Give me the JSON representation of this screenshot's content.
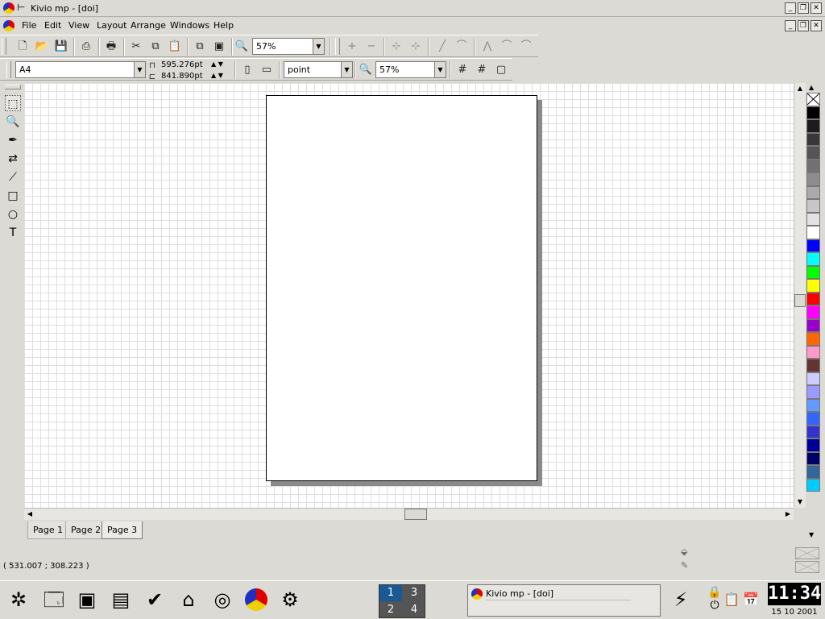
{
  "window": {
    "title": "Kivio mp - [doi]"
  },
  "menu": {
    "items": [
      "File",
      "Edit",
      "View",
      "Layout",
      "Arrange",
      "Windows",
      "Help"
    ]
  },
  "toolbar1": {
    "zoom_value": "57%",
    "icons": [
      "new-icon",
      "open-icon",
      "save-icon",
      "print-preview-icon",
      "print-icon",
      "cut-icon",
      "copy-icon",
      "paste-icon",
      "copy-to-page-icon",
      "paste-from-page-icon",
      "zoom-icon",
      "add-point-icon",
      "remove-point-icon",
      "connector-icon",
      "connector-icon",
      "line-icon",
      "curve-icon",
      "arc-icon",
      "arc-icon",
      "arc-icon"
    ]
  },
  "toolbar2": {
    "paper_size": "A4",
    "width": "595.276pt",
    "height": "841.890pt",
    "unit": "point",
    "zoom_value": "57%"
  },
  "tools": [
    "select-icon",
    "zoom-icon",
    "text-pen-icon",
    "connector-icon",
    "line-icon",
    "rectangle-icon",
    "ellipse-icon",
    "text-icon"
  ],
  "palette": {
    "colors": [
      "#000000",
      "#1c1c1c",
      "#383838",
      "#555555",
      "#717171",
      "#8d8d8d",
      "#aaaaaa",
      "#c6c6c6",
      "#e2e2e2",
      "#ffffff",
      "#0000ff",
      "#00ffff",
      "#00ff00",
      "#ffff00",
      "#ff0000",
      "#ff00ff",
      "#9900cc",
      "#ff6600",
      "#ff99cc",
      "#663333",
      "#ccccff",
      "#9999ff",
      "#6699ff",
      "#3366ff",
      "#3333cc",
      "#000099",
      "#000066",
      "#336699",
      "#00ccff"
    ]
  },
  "tabs": [
    "Page 1",
    "Page 2",
    "Page 3"
  ],
  "active_tab": "Page 3",
  "status": {
    "coordinates": "( 531.007 ; 308.223 )"
  },
  "taskbar": {
    "pager": [
      "1",
      "3",
      "2",
      "4"
    ],
    "task_title": "Kivio mp - [doi]",
    "time": "11:34",
    "date": "15 10 2001"
  }
}
